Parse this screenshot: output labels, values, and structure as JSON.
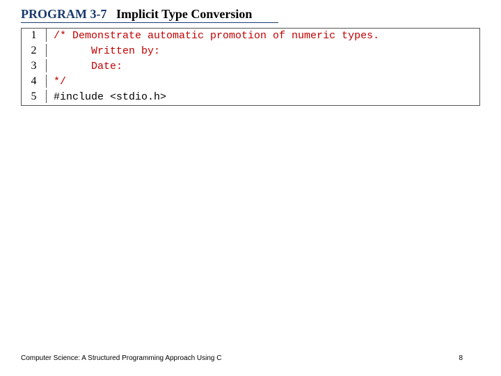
{
  "header": {
    "label": "PROGRAM 3-7",
    "title": "Implicit Type Conversion"
  },
  "code": {
    "lines": [
      {
        "n": "1",
        "text": "/* Demonstrate automatic promotion of numeric types.",
        "cls": "comment"
      },
      {
        "n": "2",
        "text": "      Written by:",
        "cls": "comment"
      },
      {
        "n": "3",
        "text": "      Date:",
        "cls": "comment"
      },
      {
        "n": "4",
        "text": "*/",
        "cls": "comment"
      },
      {
        "n": "5",
        "text": "#include <stdio.h>",
        "cls": "preproc"
      }
    ]
  },
  "footer": {
    "left": "Computer Science: A Structured Programming Approach Using C",
    "right": "8"
  }
}
